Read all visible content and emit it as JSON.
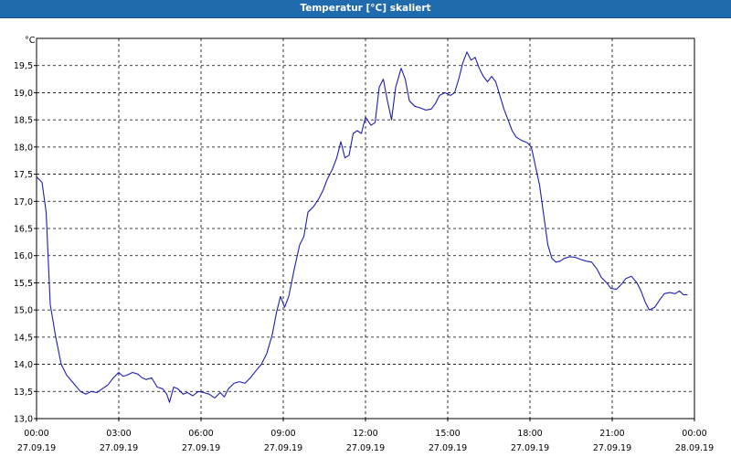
{
  "window": {
    "title": "Temperatur [°C] skaliert"
  },
  "colors": {
    "titlebar": "#1f6bad",
    "line": "#1f1fb0",
    "grid": "#000000"
  },
  "chart_data": {
    "type": "line",
    "title": "Temperatur [°C] skaliert",
    "ylabel": "°C",
    "xlabel": "",
    "ylim": [
      13.0,
      20.0
    ],
    "grid": true,
    "y_ticks": [
      "13,0",
      "13,5",
      "14,0",
      "14,5",
      "15,0",
      "15,5",
      "16,0",
      "16,5",
      "17,0",
      "17,5",
      "18,0",
      "18,5",
      "19,0",
      "19,5"
    ],
    "x_ticks": [
      {
        "time": "00:00",
        "date": "27.09.19"
      },
      {
        "time": "03:00",
        "date": "27.09.19"
      },
      {
        "time": "06:00",
        "date": "27.09.19"
      },
      {
        "time": "09:00",
        "date": "27.09.19"
      },
      {
        "time": "12:00",
        "date": "27.09.19"
      },
      {
        "time": "15:00",
        "date": "27.09.19"
      },
      {
        "time": "18:00",
        "date": "27.09.19"
      },
      {
        "time": "21:00",
        "date": "27.09.19"
      },
      {
        "time": "00:00",
        "date": "28.09.19"
      }
    ],
    "x_unit": "hours",
    "series": [
      {
        "values": [
          [
            0.0,
            17.45
          ],
          [
            0.2,
            17.35
          ],
          [
            0.35,
            16.8
          ],
          [
            0.5,
            15.1
          ],
          [
            0.7,
            14.5
          ],
          [
            0.9,
            14.0
          ],
          [
            1.1,
            13.8
          ],
          [
            1.35,
            13.65
          ],
          [
            1.6,
            13.5
          ],
          [
            1.8,
            13.45
          ],
          [
            2.0,
            13.5
          ],
          [
            2.2,
            13.48
          ],
          [
            2.4,
            13.55
          ],
          [
            2.6,
            13.62
          ],
          [
            2.8,
            13.75
          ],
          [
            3.0,
            13.85
          ],
          [
            3.15,
            13.78
          ],
          [
            3.3,
            13.8
          ],
          [
            3.5,
            13.85
          ],
          [
            3.7,
            13.82
          ],
          [
            3.85,
            13.75
          ],
          [
            4.0,
            13.72
          ],
          [
            4.2,
            13.75
          ],
          [
            4.4,
            13.58
          ],
          [
            4.6,
            13.55
          ],
          [
            4.75,
            13.45
          ],
          [
            4.85,
            13.3
          ],
          [
            5.0,
            13.58
          ],
          [
            5.15,
            13.55
          ],
          [
            5.35,
            13.45
          ],
          [
            5.5,
            13.48
          ],
          [
            5.7,
            13.42
          ],
          [
            5.9,
            13.5
          ],
          [
            6.1,
            13.48
          ],
          [
            6.3,
            13.45
          ],
          [
            6.5,
            13.38
          ],
          [
            6.7,
            13.48
          ],
          [
            6.85,
            13.4
          ],
          [
            7.0,
            13.55
          ],
          [
            7.2,
            13.65
          ],
          [
            7.4,
            13.68
          ],
          [
            7.6,
            13.65
          ],
          [
            7.8,
            13.75
          ],
          [
            8.0,
            13.88
          ],
          [
            8.2,
            14.0
          ],
          [
            8.4,
            14.2
          ],
          [
            8.6,
            14.55
          ],
          [
            8.75,
            14.95
          ],
          [
            8.9,
            15.25
          ],
          [
            9.05,
            15.05
          ],
          [
            9.2,
            15.25
          ],
          [
            9.4,
            15.75
          ],
          [
            9.6,
            16.2
          ],
          [
            9.75,
            16.35
          ],
          [
            9.9,
            16.8
          ],
          [
            10.1,
            16.9
          ],
          [
            10.3,
            17.05
          ],
          [
            10.45,
            17.2
          ],
          [
            10.6,
            17.4
          ],
          [
            10.8,
            17.6
          ],
          [
            10.95,
            17.8
          ],
          [
            11.1,
            18.1
          ],
          [
            11.25,
            17.8
          ],
          [
            11.4,
            17.85
          ],
          [
            11.55,
            18.25
          ],
          [
            11.7,
            18.3
          ],
          [
            11.85,
            18.25
          ],
          [
            12.0,
            18.55
          ],
          [
            12.2,
            18.4
          ],
          [
            12.35,
            18.45
          ],
          [
            12.5,
            19.1
          ],
          [
            12.65,
            19.25
          ],
          [
            12.8,
            18.85
          ],
          [
            12.95,
            18.5
          ],
          [
            13.1,
            19.1
          ],
          [
            13.3,
            19.45
          ],
          [
            13.45,
            19.25
          ],
          [
            13.6,
            18.85
          ],
          [
            13.8,
            18.75
          ],
          [
            14.0,
            18.72
          ],
          [
            14.2,
            18.68
          ],
          [
            14.4,
            18.7
          ],
          [
            14.55,
            18.8
          ],
          [
            14.7,
            18.95
          ],
          [
            14.9,
            19.0
          ],
          [
            15.1,
            18.95
          ],
          [
            15.25,
            19.0
          ],
          [
            15.4,
            19.25
          ],
          [
            15.55,
            19.55
          ],
          [
            15.7,
            19.75
          ],
          [
            15.85,
            19.6
          ],
          [
            16.0,
            19.65
          ],
          [
            16.15,
            19.45
          ],
          [
            16.3,
            19.3
          ],
          [
            16.45,
            19.2
          ],
          [
            16.6,
            19.3
          ],
          [
            16.75,
            19.2
          ],
          [
            16.9,
            18.95
          ],
          [
            17.05,
            18.7
          ],
          [
            17.2,
            18.5
          ],
          [
            17.35,
            18.3
          ],
          [
            17.5,
            18.18
          ],
          [
            17.7,
            18.12
          ],
          [
            17.9,
            18.08
          ],
          [
            18.05,
            18.0
          ],
          [
            18.2,
            17.65
          ],
          [
            18.35,
            17.3
          ],
          [
            18.5,
            16.75
          ],
          [
            18.65,
            16.2
          ],
          [
            18.8,
            15.95
          ],
          [
            18.95,
            15.88
          ],
          [
            19.1,
            15.9
          ],
          [
            19.25,
            15.95
          ],
          [
            19.45,
            15.98
          ],
          [
            19.65,
            15.97
          ],
          [
            19.85,
            15.93
          ],
          [
            20.05,
            15.9
          ],
          [
            20.25,
            15.88
          ],
          [
            20.45,
            15.75
          ],
          [
            20.6,
            15.6
          ],
          [
            20.8,
            15.5
          ],
          [
            20.95,
            15.4
          ],
          [
            21.15,
            15.38
          ],
          [
            21.35,
            15.48
          ],
          [
            21.5,
            15.58
          ],
          [
            21.7,
            15.62
          ],
          [
            21.9,
            15.5
          ],
          [
            22.05,
            15.35
          ],
          [
            22.2,
            15.15
          ],
          [
            22.35,
            15.0
          ],
          [
            22.55,
            15.05
          ],
          [
            22.75,
            15.2
          ],
          [
            22.9,
            15.3
          ],
          [
            23.1,
            15.32
          ],
          [
            23.3,
            15.3
          ],
          [
            23.45,
            15.35
          ],
          [
            23.6,
            15.28
          ],
          [
            23.75,
            15.28
          ]
        ]
      }
    ]
  }
}
